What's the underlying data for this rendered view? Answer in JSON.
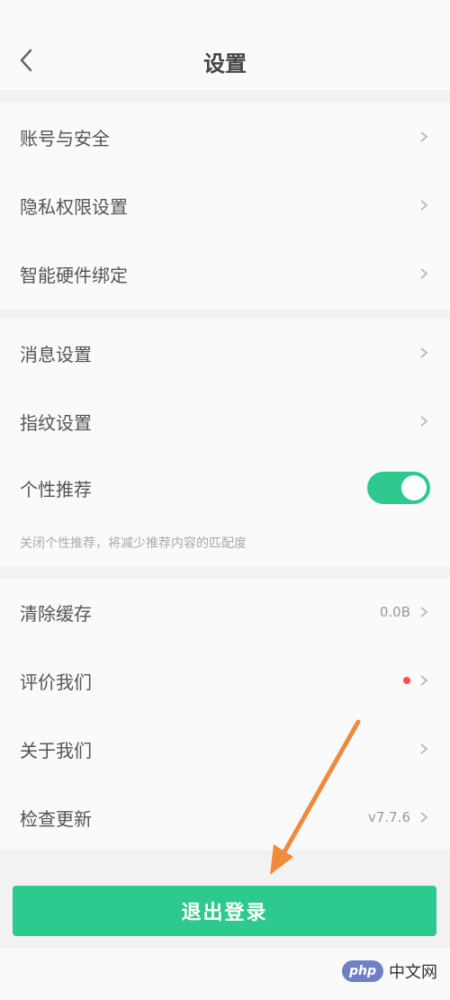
{
  "status_bar": {
    "left": "",
    "right": ""
  },
  "nav": {
    "title": "设置"
  },
  "groups": [
    {
      "items": [
        {
          "label": "账号与安全"
        },
        {
          "label": "隐私权限设置"
        },
        {
          "label": "智能硬件绑定"
        }
      ]
    },
    {
      "items": [
        {
          "label": "消息设置"
        },
        {
          "label": "指纹设置"
        },
        {
          "label": "个性推荐"
        }
      ],
      "note": "关闭个性推荐，将减少推荐内容的匹配度"
    },
    {
      "items": [
        {
          "label": "清除缓存",
          "value": "0.0B"
        },
        {
          "label": "评价我们"
        },
        {
          "label": "关于我们"
        },
        {
          "label": "检查更新",
          "value": "v7.7.6"
        }
      ]
    }
  ],
  "logout": {
    "label": "退出登录"
  },
  "watermark": {
    "logo": "php",
    "text": "中文网"
  },
  "colors": {
    "accent": "#2dc98f",
    "arrow": "#f08a3c",
    "dot": "#ff4d4f"
  }
}
